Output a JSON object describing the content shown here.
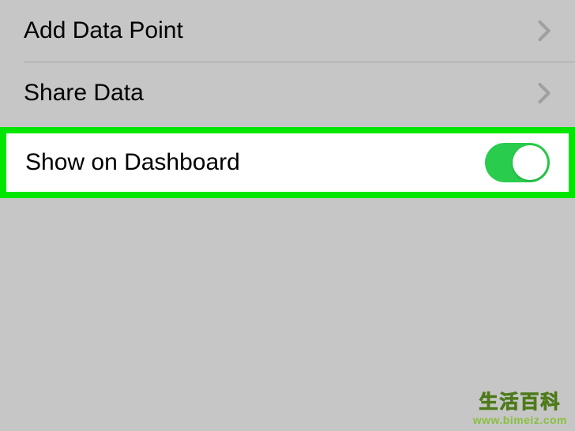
{
  "rows": {
    "addDataPoint": {
      "label": "Add Data Point"
    },
    "shareData": {
      "label": "Share Data"
    },
    "showOnDashboard": {
      "label": "Show on Dashboard",
      "toggle": true
    }
  },
  "watermark": {
    "cn": "生活百科",
    "url": "www.bimeiz.com"
  },
  "colors": {
    "highlightBorder": "#00e600",
    "toggleOn": "#29cc4c",
    "background": "#c6c6c6"
  }
}
